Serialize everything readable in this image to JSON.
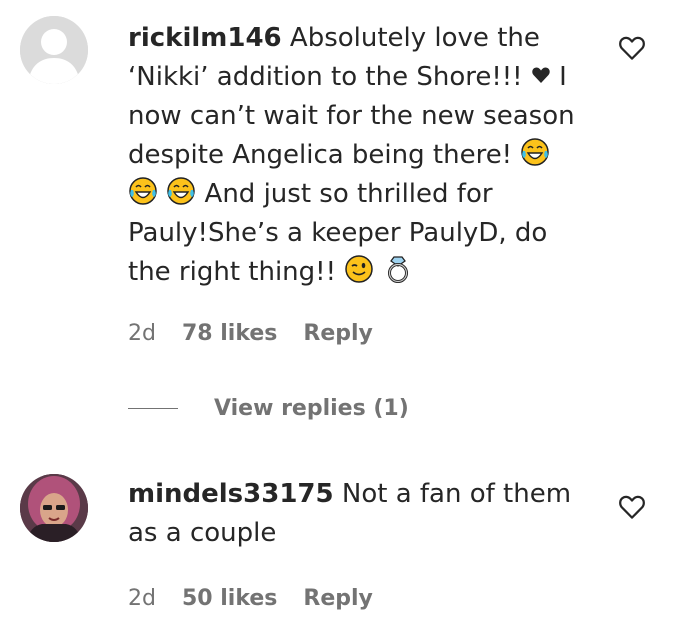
{
  "comments": [
    {
      "username": "rickilm146",
      "line1": "Absolutely love the",
      "line2a": "‘Nikki’ addition to the Shore!!!",
      "line2b": "I",
      "line3": "now can’t wait for the new season",
      "line4": "despite Angelica being there!",
      "line5": "And just so thrilled for",
      "line6": "Pauly!She’s a keeper PaulyD, do",
      "line7": "the right thing!!",
      "emojis": [
        "heart",
        "face-with-tears-of-joy",
        "face-with-tears-of-joy",
        "face-with-tears-of-joy",
        "winking-face",
        "ring"
      ],
      "time": "2d",
      "likes": "78 likes",
      "reply_label": "Reply",
      "view_replies": "View replies (1)"
    },
    {
      "username": "mindels33175",
      "line1": "Not a fan of them",
      "line2": "as a couple",
      "time": "2d",
      "likes": "50 likes",
      "reply_label": "Reply"
    }
  ],
  "colors": {
    "text": "#262626",
    "secondary": "#737373",
    "avatar_placeholder": "#dbdbdb"
  }
}
